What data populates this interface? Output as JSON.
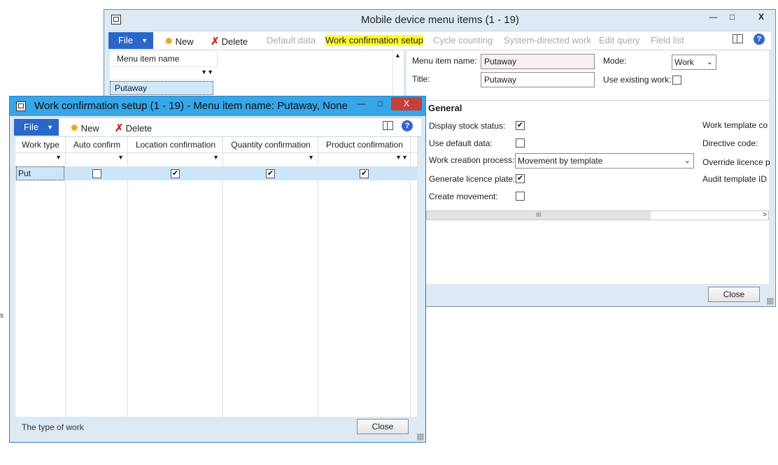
{
  "back_window": {
    "title": "Mobile device menu items (1 - 19)",
    "controls": {
      "minimize": "—",
      "maximize": "□",
      "close": "X"
    },
    "ribbon": {
      "file": "File",
      "new": "New",
      "delete": "Delete",
      "default_data": "Default data",
      "work_confirmation_setup": "Work confirmation setup",
      "cycle_counting": "Cycle counting",
      "system_directed_work": "System-directed work",
      "edit_query": "Edit query",
      "field_list": "Field list"
    },
    "list": {
      "column_header": "Menu item name",
      "selected_item": "Putaway"
    },
    "details": {
      "menu_item_name_label": "Menu item name:",
      "menu_item_name_value": "Putaway",
      "title_label": "Title:",
      "title_value": "Putaway",
      "mode_label": "Mode:",
      "mode_value": "Work",
      "use_existing_work_label": "Use existing work:",
      "use_existing_work": false,
      "general_title": "General",
      "display_stock_status_label": "Display stock status:",
      "display_stock_status": true,
      "use_default_data_label": "Use default data:",
      "use_default_data": false,
      "work_creation_process_label": "Work creation process:",
      "work_creation_process_value": "Movement by template",
      "generate_licence_plate_label": "Generate licence plate:",
      "generate_licence_plate": true,
      "create_movement_label": "Create movement:",
      "create_movement": false,
      "work_template_label": "Work template co",
      "directive_code_label": "Directive code:",
      "override_licence_label": "Override licence p",
      "audit_template_label": "Audit template ID"
    },
    "close_label": "Close"
  },
  "front_window": {
    "title": "Work confirmation setup (1 - 19) - Menu item name: Putaway, None",
    "controls": {
      "minimize": "—",
      "maximize": "□",
      "close": "X"
    },
    "ribbon": {
      "file": "File",
      "new": "New",
      "delete": "Delete"
    },
    "grid": {
      "columns": [
        "Work type",
        "Auto confirm",
        "Location confirmation",
        "Quantity confirmation",
        "Product confirmation"
      ],
      "rows": [
        {
          "work_type": "Put",
          "auto_confirm": false,
          "location_confirmation": true,
          "quantity_confirmation": true,
          "product_confirmation": true
        }
      ]
    },
    "status_text": "The type of work",
    "close_label": "Close"
  },
  "stray_text": "s",
  "colors": {
    "file_button": "#2a67c9",
    "title_bar_active": "#36a6e8",
    "close_active": "#c5403a",
    "highlight": "#ffff30",
    "selected_row": "#cde6f7"
  },
  "icons": {
    "new": "sun-icon",
    "delete": "red-x-icon",
    "help": "help-icon",
    "panel": "panel-icon"
  }
}
